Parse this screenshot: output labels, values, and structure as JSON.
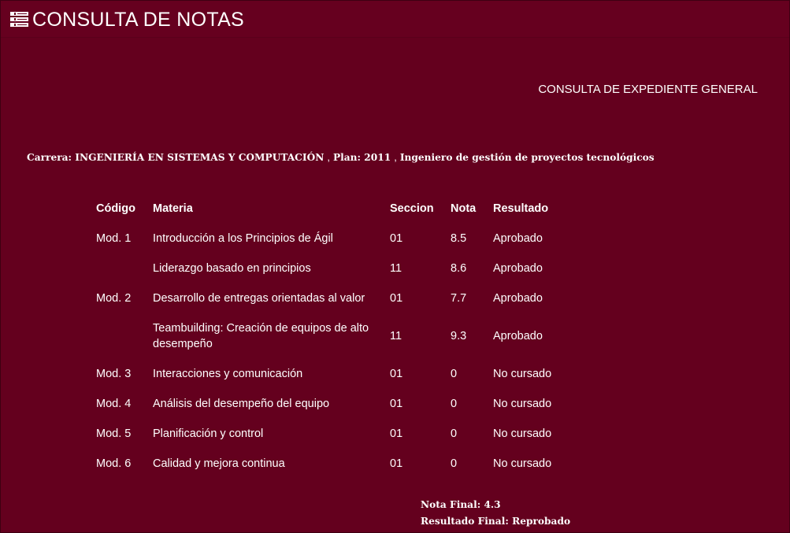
{
  "header": {
    "icon": "menu-stack-icon",
    "title": "CONSULTA DE NOTAS"
  },
  "subtitle": "CONSULTA DE EXPEDIENTE GENERAL",
  "career": {
    "career_text": "Carrera: INGENIERÍA EN SISTEMAS Y COMPUTACIÓN",
    "plan_text": "Plan: 2011",
    "degree_text": "Ingeniero de gestión de proyectos tecnológicos",
    "separator": ","
  },
  "table": {
    "headers": {
      "code": "Código",
      "subject": "Materia",
      "section": "Seccion",
      "grade": "Nota",
      "result": "Resultado"
    },
    "rows": [
      {
        "code": "Mod. 1",
        "subject": "Introducción a los Principios de Ágil",
        "section": "01",
        "grade": "8.5",
        "result": "Aprobado"
      },
      {
        "code": "",
        "subject": "Liderazgo basado en principios",
        "section": "11",
        "grade": "8.6",
        "result": "Aprobado"
      },
      {
        "code": "Mod. 2",
        "subject": "Desarrollo de entregas orientadas al valor",
        "section": "01",
        "grade": "7.7",
        "result": "Aprobado"
      },
      {
        "code": "",
        "subject": "Teambuilding: Creación de equipos de alto desempeño",
        "section": "11",
        "grade": "9.3",
        "result": "Aprobado"
      },
      {
        "code": "Mod. 3",
        "subject": "Interacciones y comunicación",
        "section": "01",
        "grade": "0",
        "result": "No cursado"
      },
      {
        "code": "Mod. 4",
        "subject": "Análisis del desempeño del equipo",
        "section": "01",
        "grade": "0",
        "result": "No cursado"
      },
      {
        "code": "Mod. 5",
        "subject": "Planificación y control",
        "section": "01",
        "grade": "0",
        "result": "No cursado"
      },
      {
        "code": "Mod. 6",
        "subject": "Calidad y mejora continua",
        "section": "01",
        "grade": "0",
        "result": "No cursado"
      }
    ]
  },
  "summary": {
    "final_grade": "Nota Final: 4.3",
    "final_result": "Resultado Final: Reprobado"
  },
  "colors": {
    "background": "#64001e",
    "text": "#ffffff"
  }
}
